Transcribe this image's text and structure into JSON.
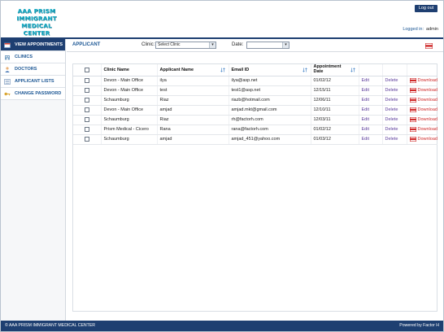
{
  "header": {
    "logo_lines": [
      "AAA PRISM",
      "IMMIGRANT",
      "MEDICAL CENTER"
    ],
    "logout_label": "Log out",
    "logged_in_label": "Logged in:",
    "username": "admin"
  },
  "sidebar": {
    "items": [
      {
        "label": "VIEW APPOINTMENTS",
        "icon": "calendar-icon",
        "active": true
      },
      {
        "label": "CLINICS",
        "icon": "clinic-icon",
        "active": false
      },
      {
        "label": "DOCTORS",
        "icon": "doctor-icon",
        "active": false
      },
      {
        "label": "APPLICANT LISTS",
        "icon": "list-icon",
        "active": false
      },
      {
        "label": "CHANGE PASSWORD",
        "icon": "key-icon",
        "active": false
      }
    ]
  },
  "filters": {
    "section_title": "APPLICANT",
    "clinic_label": "Clinic:",
    "clinic_value": "Select Clinic",
    "date_label": "Date:",
    "date_value": ""
  },
  "table": {
    "columns": [
      "Clinic Name",
      "Applicant Name",
      "Email ID",
      "Appointment Date"
    ],
    "edit_label": "Edit",
    "delete_label": "Delete",
    "download_label": "Download",
    "rows": [
      {
        "clinic": "Devon - Main Office",
        "name": "ilya",
        "email": "ilya@asp.net",
        "date": "01/02/12"
      },
      {
        "clinic": "Devon - Main Office",
        "name": "test",
        "email": "test1@asp.net",
        "date": "12/15/11"
      },
      {
        "clinic": "Schaumburg",
        "name": "Riaz",
        "email": "riazb@hotmail.com",
        "date": "12/06/11"
      },
      {
        "clinic": "Devon - Main Office",
        "name": "amjad",
        "email": "amjad.mkt@gmail.com",
        "date": "12/10/11"
      },
      {
        "clinic": "Schaumburg",
        "name": "Riaz",
        "email": "rh@factorh.com",
        "date": "12/03/11"
      },
      {
        "clinic": "Prism Medical - Cicero",
        "name": "Rana",
        "email": "rana@factorh.com",
        "date": "01/02/12"
      },
      {
        "clinic": "Schaumburg",
        "name": "amjad",
        "email": "amjad_451@yahoo.com",
        "date": "01/03/12"
      }
    ]
  },
  "footer": {
    "copyright": "© AAA PRISM IMMIGRANT MEDICAL CENTER",
    "powered_by": "Powered by Factor H"
  },
  "colors": {
    "brand": "#1e3f71",
    "logo": "#1bb0c9",
    "link": "#5b3b9b",
    "download": "#cf2a2a"
  }
}
